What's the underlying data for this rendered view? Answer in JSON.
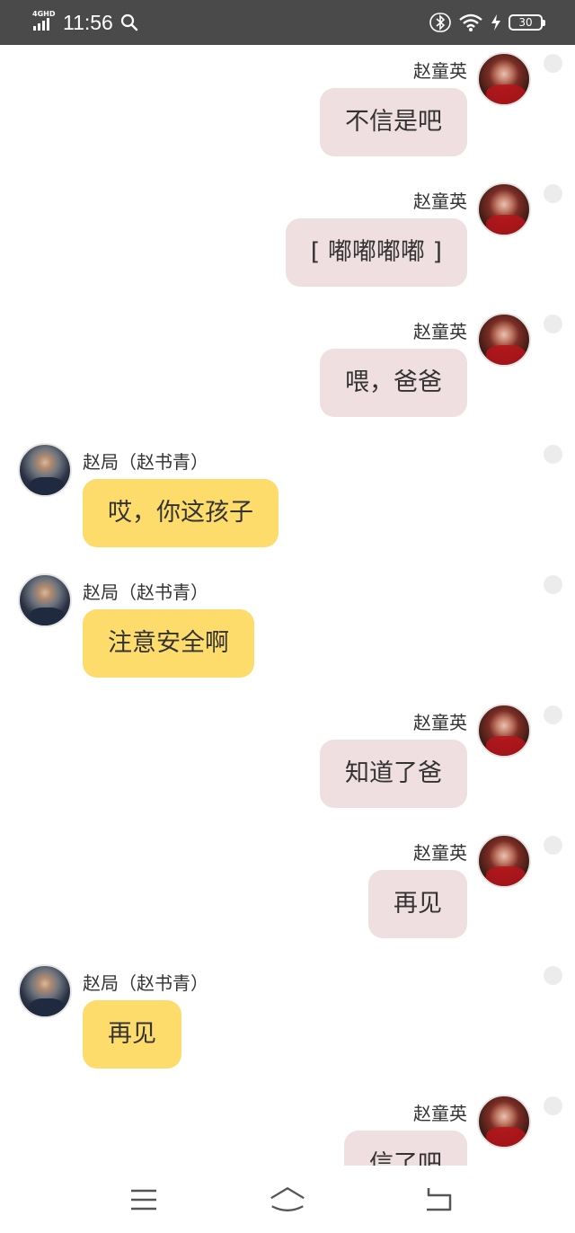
{
  "status_bar": {
    "network_label": "4GHD",
    "time": "11:56",
    "battery": "30"
  },
  "contacts": {
    "her": "赵童英",
    "him": "赵局（赵书青）"
  },
  "messages": [
    {
      "sender": "赵童英",
      "side": "right",
      "text": "不信是吧"
    },
    {
      "sender": "赵童英",
      "side": "right",
      "text": "[ 嘟嘟嘟嘟 ]"
    },
    {
      "sender": "赵童英",
      "side": "right",
      "text": "喂，爸爸"
    },
    {
      "sender": "赵局（赵书青）",
      "side": "left",
      "text": "哎，你这孩子"
    },
    {
      "sender": "赵局（赵书青）",
      "side": "left",
      "text": "注意安全啊"
    },
    {
      "sender": "赵童英",
      "side": "right",
      "text": "知道了爸"
    },
    {
      "sender": "赵童英",
      "side": "right",
      "text": "再见"
    },
    {
      "sender": "赵局（赵书青）",
      "side": "left",
      "text": "再见"
    },
    {
      "sender": "赵童英",
      "side": "right",
      "text": "信了吧"
    }
  ],
  "nav_icons": [
    "menu-icon",
    "home-icon",
    "back-icon"
  ],
  "colors": {
    "status_bar_bg": "#4a4a4a",
    "outgoing_bubble": "#f0dfe1",
    "incoming_bubble": "#fedc6b"
  }
}
